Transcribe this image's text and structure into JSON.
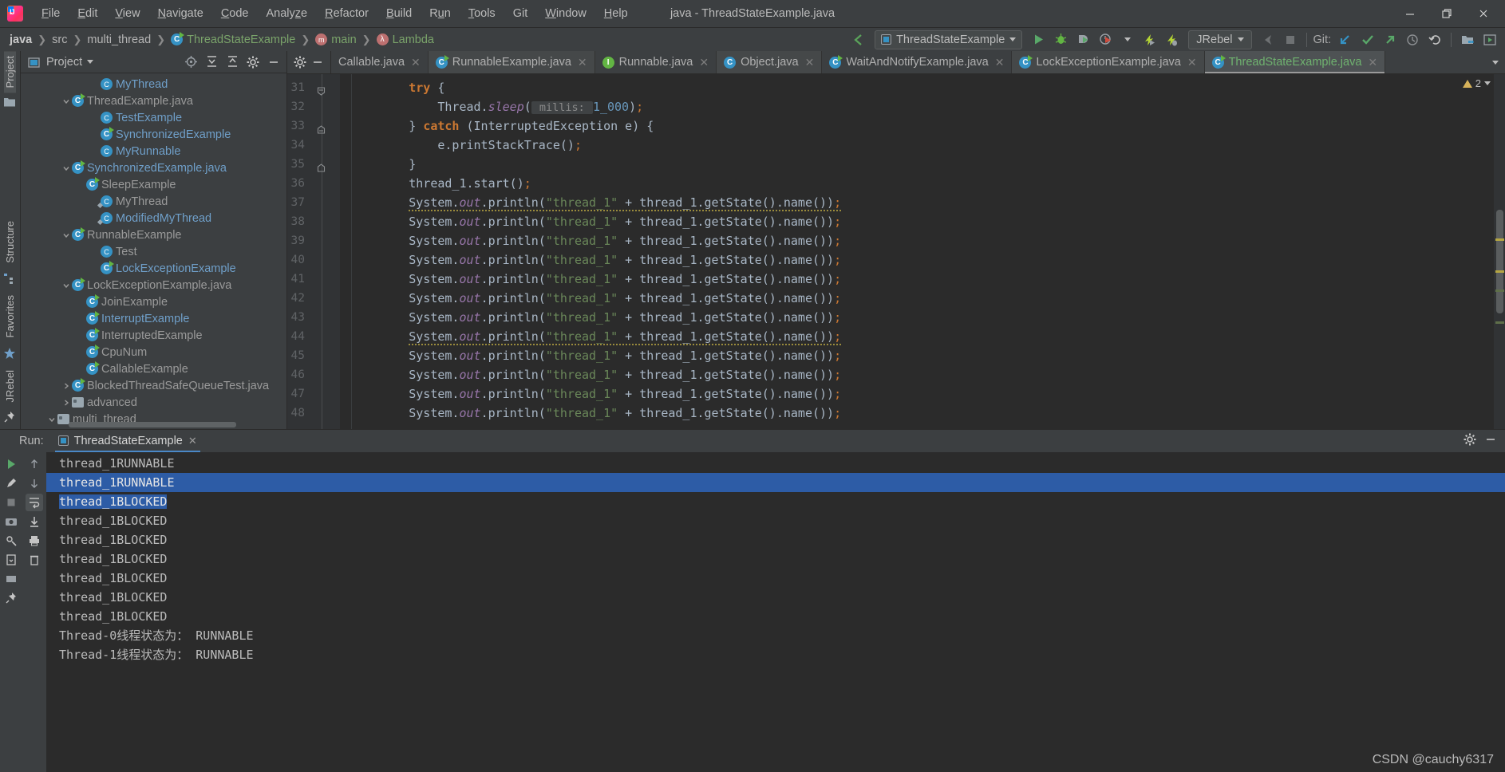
{
  "window": {
    "title": "java - ThreadStateExample.java",
    "logo_alt": "intellij-idea-logo"
  },
  "menu": {
    "items": [
      {
        "label": "File",
        "mnemonic": "F"
      },
      {
        "label": "Edit",
        "mnemonic": "E"
      },
      {
        "label": "View",
        "mnemonic": "V"
      },
      {
        "label": "Navigate",
        "mnemonic": "N"
      },
      {
        "label": "Code",
        "mnemonic": "C"
      },
      {
        "label": "Analyze",
        "mnemonic": "z"
      },
      {
        "label": "Refactor",
        "mnemonic": "R"
      },
      {
        "label": "Build",
        "mnemonic": "B"
      },
      {
        "label": "Run",
        "mnemonic": "u"
      },
      {
        "label": "Tools",
        "mnemonic": "T"
      },
      {
        "label": "Git",
        "mnemonic": ""
      },
      {
        "label": "Window",
        "mnemonic": "W"
      },
      {
        "label": "Help",
        "mnemonic": "H"
      }
    ]
  },
  "window_controls": {
    "minimize": "—",
    "restore": "❐",
    "close": "✕"
  },
  "breadcrumbs": [
    {
      "label": "java",
      "icon": "",
      "style": "bold"
    },
    {
      "label": "src",
      "icon": "",
      "style": "plain"
    },
    {
      "label": "multi_thread",
      "icon": "",
      "style": "plain"
    },
    {
      "label": "ThreadStateExample",
      "icon": "class-icon",
      "style": "green"
    },
    {
      "label": "main",
      "icon": "method-icon",
      "style": "green"
    },
    {
      "label": "Lambda",
      "icon": "lambda-icon",
      "style": "green"
    }
  ],
  "toolbar": {
    "back_icon": "back-arrow-icon",
    "run_config": "ThreadStateExample",
    "run_icon": "run-icon",
    "debug_icon": "debug-icon",
    "run_with_coverage_icon": "run-coverage-icon",
    "profile_icon": "profiler-icon",
    "jrebel_run_icon": "jrebel-run-icon",
    "jrebel_debug_icon": "jrebel-debug-icon",
    "jrebel_label": "JRebel",
    "stop_icon": "stop-icon",
    "git_label": "Git:",
    "git_update_icon": "update-project-icon",
    "git_commit_icon": "commit-icon",
    "git_push_icon": "push-icon",
    "git_history_icon": "history-icon",
    "git_rollback_icon": "rollback-icon",
    "search_icon": "search-everywhere-icon",
    "project_structure_icon": "project-structure-icon",
    "more_icon": "more-icon"
  },
  "left_strip": {
    "project_label": "Project",
    "structure_label": "Structure",
    "favorites_label": "Favorites",
    "jrebel_label": "JRebel"
  },
  "project_panel": {
    "title": "Project",
    "dropdown_icon": "chevron-down-icon",
    "locate_icon": "locate-file-icon",
    "expand_icon": "expand-all-icon",
    "collapse_icon": "collapse-all-icon",
    "settings_icon": "gear-icon",
    "hide_icon": "hide-icon",
    "tree": [
      {
        "label": "multi_thread",
        "indent": 1,
        "twist": "down",
        "icon": "folder-icon",
        "color": "normal"
      },
      {
        "label": "advanced",
        "indent": 2,
        "twist": "right",
        "icon": "folder-icon",
        "color": "normal"
      },
      {
        "label": "BlockedThreadSafeQueueTest.java",
        "indent": 2,
        "twist": "right",
        "icon": "class-run-icon",
        "color": "normal"
      },
      {
        "label": "CallableExample",
        "indent": 3,
        "twist": "none",
        "icon": "class-run-icon",
        "color": "normal"
      },
      {
        "label": "CpuNum",
        "indent": 3,
        "twist": "none",
        "icon": "class-run-icon",
        "color": "normal"
      },
      {
        "label": "InterruptedExample",
        "indent": 3,
        "twist": "none",
        "icon": "class-run-icon",
        "color": "normal"
      },
      {
        "label": "InterruptExample",
        "indent": 3,
        "twist": "none",
        "icon": "class-run-icon",
        "color": "highlight"
      },
      {
        "label": "JoinExample",
        "indent": 3,
        "twist": "none",
        "icon": "class-run-icon",
        "color": "normal"
      },
      {
        "label": "LockExceptionExample.java",
        "indent": 2,
        "twist": "down",
        "icon": "class-run-icon",
        "color": "normal"
      },
      {
        "label": "LockExceptionExample",
        "indent": 4,
        "twist": "none",
        "icon": "class-run-icon",
        "color": "highlight"
      },
      {
        "label": "Test",
        "indent": 4,
        "twist": "none",
        "icon": "class-icon",
        "color": "normal"
      },
      {
        "label": "RunnableExample",
        "indent": 2,
        "twist": "down",
        "icon": "class-run-icon",
        "color": "normal"
      },
      {
        "label": "ModifiedMyThread",
        "indent": 4,
        "twist": "none",
        "icon": "anon-class-icon",
        "color": "highlight"
      },
      {
        "label": "MyThread",
        "indent": 4,
        "twist": "none",
        "icon": "anon-class-icon",
        "color": "normal"
      },
      {
        "label": "SleepExample",
        "indent": 3,
        "twist": "none",
        "icon": "class-run-icon",
        "color": "normal"
      },
      {
        "label": "SynchronizedExample.java",
        "indent": 2,
        "twist": "down",
        "icon": "class-run-icon",
        "color": "highlight"
      },
      {
        "label": "MyRunnable",
        "indent": 4,
        "twist": "none",
        "icon": "class-icon",
        "color": "highlight"
      },
      {
        "label": "SynchronizedExample",
        "indent": 4,
        "twist": "none",
        "icon": "class-run-icon",
        "color": "highlight"
      },
      {
        "label": "TestExample",
        "indent": 4,
        "twist": "none",
        "icon": "class-icon",
        "color": "highlight"
      },
      {
        "label": "ThreadExample.java",
        "indent": 2,
        "twist": "down",
        "icon": "class-run-icon",
        "color": "normal"
      },
      {
        "label": "MyThread",
        "indent": 4,
        "twist": "none",
        "icon": "class-icon",
        "color": "highlight"
      }
    ]
  },
  "editor": {
    "tabs": [
      {
        "label": "Callable.java",
        "icon": "none",
        "active": false
      },
      {
        "label": "RunnableExample.java",
        "icon": "class-run-icon",
        "active": false
      },
      {
        "label": "Runnable.java",
        "icon": "interface-lock-icon",
        "active": false
      },
      {
        "label": "Object.java",
        "icon": "class-lock-icon",
        "active": false
      },
      {
        "label": "WaitAndNotifyExample.java",
        "icon": "class-run-icon",
        "active": false
      },
      {
        "label": "LockExceptionExample.java",
        "icon": "class-run-icon",
        "active": false
      },
      {
        "label": "ThreadStateExample.java",
        "icon": "class-run-icon",
        "active": true
      }
    ],
    "tab_close_icon": "close-icon",
    "tab_overflow_icon": "chevron-down-icon",
    "gear_icon": "gear-icon",
    "hide_icon": "hide-icon",
    "inspection_count": "2",
    "lines": [
      {
        "no": "31",
        "fold": "start",
        "html": "        <span class=\"kw\">try</span> {"
      },
      {
        "no": "32",
        "fold": "none",
        "html": "            Thread.<span class=\"fld\">sleep</span>(<span class=\"hint\"> millis: </span><span class=\"num\">1_000</span>)<span class=\"sem\">;</span>"
      },
      {
        "no": "33",
        "fold": "mid",
        "html": "        } <span class=\"kw\">catch</span> (InterruptedException e) {"
      },
      {
        "no": "34",
        "fold": "none",
        "html": "            e.printStackTrace()<span class=\"sem\">;</span>"
      },
      {
        "no": "35",
        "fold": "end",
        "html": "        }"
      },
      {
        "no": "36",
        "fold": "none",
        "html": "        thread_1.start()<span class=\"sem\">;</span>"
      },
      {
        "no": "37",
        "fold": "none",
        "html": "        <span class=\"warnu\">System.<span class=\"fld\">out</span>.println(<span class=\"str\">\"thread_1\"</span> + thread_1.getState().name())<span class=\"sem\">;</span></span>"
      },
      {
        "no": "38",
        "fold": "none",
        "html": "        System.<span class=\"fld\">out</span>.println(<span class=\"str\">\"thread_1\"</span> + thread_1.getState().name())<span class=\"sem\">;</span>"
      },
      {
        "no": "39",
        "fold": "none",
        "html": "        System.<span class=\"fld\">out</span>.println(<span class=\"str\">\"thread_1\"</span> + thread_1.getState().name())<span class=\"sem\">;</span>"
      },
      {
        "no": "40",
        "fold": "none",
        "html": "        System.<span class=\"fld\">out</span>.println(<span class=\"str\">\"thread_1\"</span> + thread_1.getState().name())<span class=\"sem\">;</span>"
      },
      {
        "no": "41",
        "fold": "none",
        "html": "        System.<span class=\"fld\">out</span>.println(<span class=\"str\">\"thread_1\"</span> + thread_1.getState().name())<span class=\"sem\">;</span>"
      },
      {
        "no": "42",
        "fold": "none",
        "html": "        System.<span class=\"fld\">out</span>.println(<span class=\"str\">\"thread_1\"</span> + thread_1.getState().name())<span class=\"sem\">;</span>"
      },
      {
        "no": "43",
        "fold": "none",
        "html": "        System.<span class=\"fld\">out</span>.println(<span class=\"str\">\"thread_1\"</span> + thread_1.getState().name())<span class=\"sem\">;</span>"
      },
      {
        "no": "44",
        "fold": "none",
        "html": "        <span class=\"warnu\">System.<span class=\"fld\">out</span>.println(<span class=\"str\">\"thread_1\"</span> + thread_1.getState().name())<span class=\"sem\">;</span></span>"
      },
      {
        "no": "45",
        "fold": "none",
        "html": "        System.<span class=\"fld\">out</span>.println(<span class=\"str\">\"thread_1\"</span> + thread_1.getState().name())<span class=\"sem\">;</span>"
      },
      {
        "no": "46",
        "fold": "none",
        "html": "        System.<span class=\"fld\">out</span>.println(<span class=\"str\">\"thread_1\"</span> + thread_1.getState().name())<span class=\"sem\">;</span>"
      },
      {
        "no": "47",
        "fold": "none",
        "html": "        System.<span class=\"fld\">out</span>.println(<span class=\"str\">\"thread_1\"</span> + thread_1.getState().name())<span class=\"sem\">;</span>"
      },
      {
        "no": "48",
        "fold": "none",
        "html": "        System.<span class=\"fld\">out</span>.println(<span class=\"str\">\"thread_1\"</span> + thread_1.getState().name())<span class=\"sem\">;</span>"
      }
    ]
  },
  "run_window": {
    "label": "Run:",
    "tab_label": "ThreadStateExample",
    "tab_close_icon": "close-icon",
    "settings_icon": "gear-icon",
    "hide_icon": "hide-icon",
    "toolbar_icons": [
      "rerun-icon",
      "edit-configuration-icon",
      "stop-icon",
      "scroll-up-icon",
      "scroll-down-icon",
      "soft-wrap-icon",
      "scroll-to-end-icon",
      "print-icon",
      "clear-all-icon"
    ],
    "console_lines": [
      {
        "text": "thread_1RUNNABLE",
        "selection": "none"
      },
      {
        "text": "thread_1RUNNABLE",
        "selection": "full"
      },
      {
        "text": "thread_1BLOCKED",
        "selection": "text"
      },
      {
        "text": "thread_1BLOCKED",
        "selection": "none"
      },
      {
        "text": "thread_1BLOCKED",
        "selection": "none"
      },
      {
        "text": "thread_1BLOCKED",
        "selection": "none"
      },
      {
        "text": "thread_1BLOCKED",
        "selection": "none"
      },
      {
        "text": "thread_1BLOCKED",
        "selection": "none"
      },
      {
        "text": "thread_1BLOCKED",
        "selection": "none"
      },
      {
        "text": "Thread-0线程状态为： RUNNABLE",
        "selection": "none"
      },
      {
        "text": "Thread-1线程状态为： RUNNABLE",
        "selection": "none"
      }
    ]
  },
  "watermark": "CSDN @cauchy6317",
  "colors": {
    "panel_bg": "#3c3f41",
    "editor_bg": "#2b2b2b",
    "gutter_bg": "#313335",
    "accent_blue": "#4a88c7",
    "selection_blue": "#2d5ca6",
    "keyword_orange": "#cc7832",
    "string_green": "#6a8759",
    "number_blue": "#6897bb",
    "field_purple": "#9876aa",
    "tree_highlight": "#6f9fc9",
    "active_tab_green": "#6fb26f",
    "run_green": "#62b543",
    "class_icon_blue": "#3592c4"
  }
}
